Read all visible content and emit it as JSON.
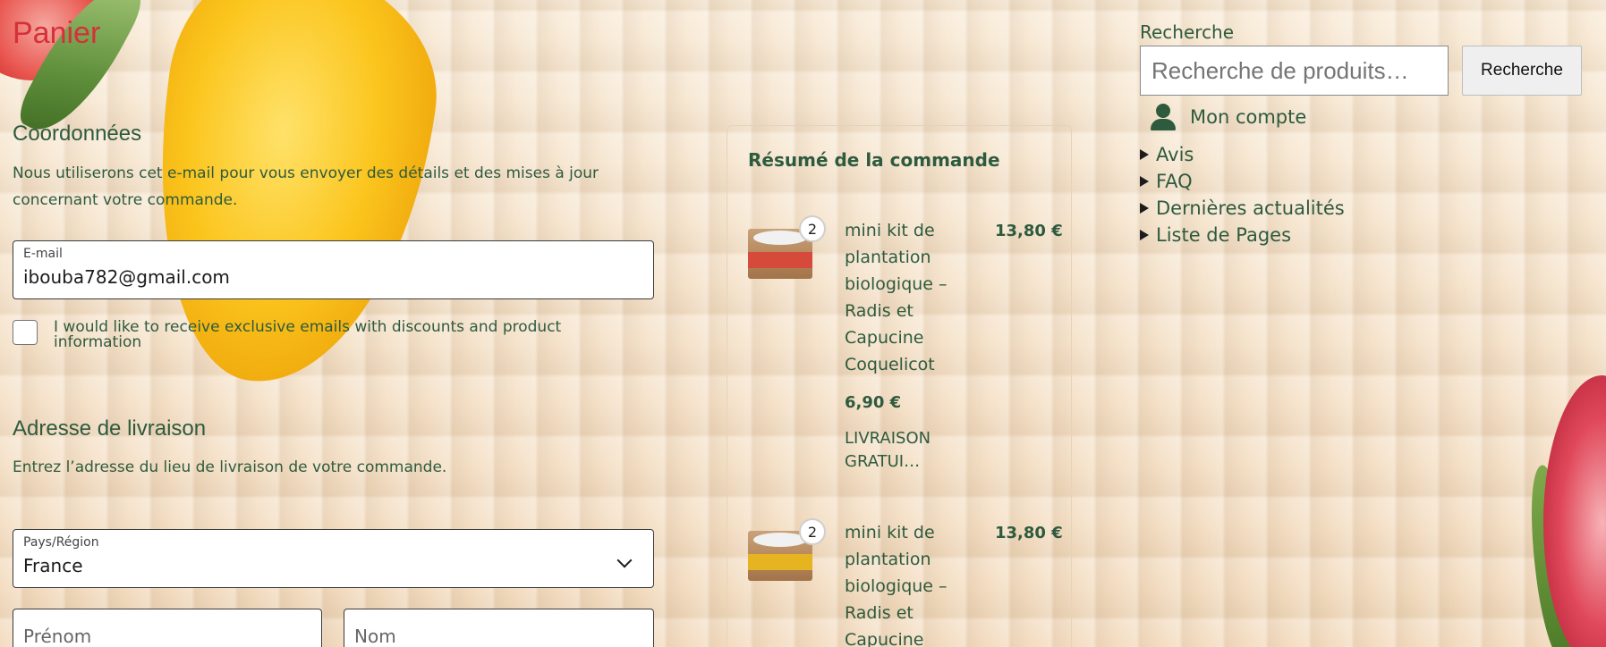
{
  "page_title": "Panier",
  "contact": {
    "heading": "Coordonnées",
    "description": "Nous utiliserons cet e-mail pour vous envoyer des détails et des mises à jour concernant votre commande.",
    "email_label": "E-mail",
    "email_value": "ibouba782@gmail.com",
    "newsletter_label": "I would like to receive exclusive emails with discounts and product information"
  },
  "shipping": {
    "heading": "Adresse de livraison",
    "description": "Entrez l’adresse du lieu de livraison de votre commande.",
    "country_label": "Pays/Région",
    "country_value": "France",
    "firstname_placeholder": "Prénom",
    "lastname_placeholder": "Nom"
  },
  "summary": {
    "title": "Résumé de la commande",
    "items": [
      {
        "quantity": "2",
        "name": "mini kit de plantation biologique – Radis et Capucine Coquelicot",
        "total": "13,80 €",
        "unit_price": "6,90 €",
        "note": "LIVRAISON GRATUI…",
        "label_color": "#d64a3c"
      },
      {
        "quantity": "2",
        "name": "mini kit de plantation biologique – Radis et Capucine",
        "total": "13,80 €",
        "label_color": "#e6b420"
      }
    ]
  },
  "sidebar": {
    "search_label": "Recherche",
    "search_placeholder": "Recherche de produits…",
    "search_button": "Recherche",
    "account_label": "Mon compte",
    "nav_items": [
      "Avis",
      "FAQ",
      "Dernières actualités",
      "Liste de Pages"
    ]
  },
  "colors": {
    "title_red": "#d6303a",
    "text_green": "#2e5a3e"
  }
}
